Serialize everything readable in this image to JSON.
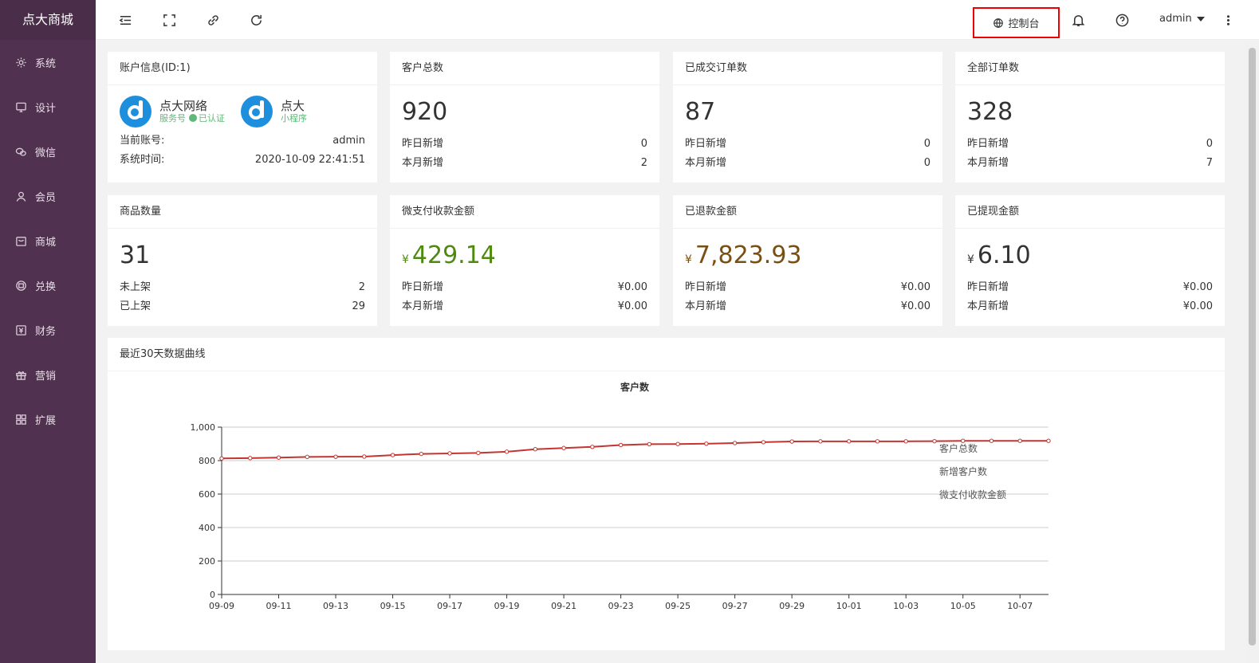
{
  "brand": "点大商城",
  "sidebar": {
    "items": [
      {
        "label": "系统",
        "icon": "gear-icon"
      },
      {
        "label": "设计",
        "icon": "monitor-icon"
      },
      {
        "label": "微信",
        "icon": "wechat-icon"
      },
      {
        "label": "会员",
        "icon": "user-icon"
      },
      {
        "label": "商城",
        "icon": "shop-icon"
      },
      {
        "label": "兑换",
        "icon": "exchange-icon"
      },
      {
        "label": "财务",
        "icon": "finance-icon"
      },
      {
        "label": "营销",
        "icon": "gift-icon"
      },
      {
        "label": "扩展",
        "icon": "grid-icon"
      }
    ]
  },
  "header": {
    "console_label": "控制台",
    "user_label": "admin",
    "icons": [
      "menu-fold-icon",
      "fullscreen-icon",
      "link-icon",
      "refresh-icon",
      "globe-icon",
      "bell-icon",
      "help-icon",
      "more-icon"
    ]
  },
  "account": {
    "title": "账户信息(ID:1)",
    "service_name": "点大网络",
    "service_type": "服务号",
    "verified": "已认证",
    "mini_name": "点大",
    "mini_type": "小程序",
    "current_account_label": "当前账号:",
    "current_account_value": "admin",
    "system_time_label": "系统时间:",
    "system_time_value": "2020-10-09 22:41:51"
  },
  "stats": [
    {
      "title": "客户总数",
      "value": "920",
      "rows": [
        {
          "label": "昨日新增",
          "value": "0"
        },
        {
          "label": "本月新增",
          "value": "2"
        }
      ]
    },
    {
      "title": "已成交订单数",
      "value": "87",
      "rows": [
        {
          "label": "昨日新增",
          "value": "0"
        },
        {
          "label": "本月新增",
          "value": "0"
        }
      ]
    },
    {
      "title": "全部订单数",
      "value": "328",
      "rows": [
        {
          "label": "昨日新增",
          "value": "0"
        },
        {
          "label": "本月新增",
          "value": "7"
        }
      ]
    },
    {
      "title": "商品数量",
      "value": "31",
      "rows": [
        {
          "label": "未上架",
          "value": "2"
        },
        {
          "label": "已上架",
          "value": "29"
        }
      ]
    },
    {
      "title": "微支付收款金额",
      "currency": "¥",
      "value": "429.14",
      "color": "#4e8a10",
      "rows": [
        {
          "label": "昨日新增",
          "value": "¥0.00"
        },
        {
          "label": "本月新增",
          "value": "¥0.00"
        }
      ]
    },
    {
      "title": "已退款金额",
      "currency": "¥",
      "value": "7,823.93",
      "color": "#7a4f12",
      "rows": [
        {
          "label": "昨日新增",
          "value": "¥0.00"
        },
        {
          "label": "本月新增",
          "value": "¥0.00"
        }
      ]
    },
    {
      "title": "已提现金额",
      "currency": "¥",
      "value": "6.10",
      "color": "#333333",
      "rows": [
        {
          "label": "昨日新增",
          "value": "¥0.00"
        },
        {
          "label": "本月新增",
          "value": "¥0.00"
        }
      ]
    }
  ],
  "chart_card_title": "最近30天数据曲线",
  "chart_data": {
    "type": "line",
    "title": "客户数",
    "ylim": [
      0,
      1000
    ],
    "yticks": [
      "0",
      "200",
      "400",
      "600",
      "800",
      "1,000"
    ],
    "ytick_values": [
      0,
      200,
      400,
      600,
      800,
      1000
    ],
    "x": [
      "09-09",
      "09-10",
      "09-11",
      "09-12",
      "09-13",
      "09-14",
      "09-15",
      "09-16",
      "09-17",
      "09-18",
      "09-19",
      "09-20",
      "09-21",
      "09-22",
      "09-23",
      "09-24",
      "09-25",
      "09-26",
      "09-27",
      "09-28",
      "09-29",
      "09-30",
      "10-01",
      "10-02",
      "10-03",
      "10-04",
      "10-05",
      "10-06",
      "10-07",
      "10-08"
    ],
    "xtick_labels": [
      "09-09",
      "09-11",
      "09-13",
      "09-15",
      "09-17",
      "09-19",
      "09-21",
      "09-23",
      "09-25",
      "09-27",
      "09-29",
      "10-01",
      "10-03",
      "10-05",
      "10-07"
    ],
    "legend": [
      "客户总数",
      "新增客户数",
      "微支付收款金额"
    ],
    "legend_position": "right",
    "series": [
      {
        "name": "客户总数",
        "color": "#c23531",
        "values": [
          813,
          815,
          818,
          822,
          823,
          824,
          833,
          840,
          843,
          846,
          853,
          868,
          875,
          882,
          893,
          898,
          899,
          901,
          905,
          910,
          914,
          915,
          915,
          915,
          915,
          916,
          918,
          918,
          918,
          918
        ]
      }
    ]
  }
}
